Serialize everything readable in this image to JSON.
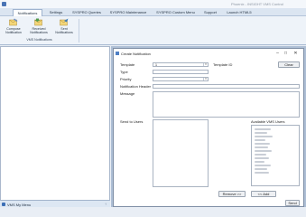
{
  "app": {
    "title": "Phoenix - INSIGHT VMS Control",
    "colors": {
      "accent": "#4a74b5",
      "ribbon": "#eef3f9",
      "workspace": "#aebfd5"
    }
  },
  "quick_access": {
    "icon": "app-menu-icon"
  },
  "tabs": [
    {
      "label": "Notifications",
      "active": true
    },
    {
      "label": "Settings",
      "active": false
    },
    {
      "label": "SYSPRO Queries",
      "active": false
    },
    {
      "label": "SYSPRO Maintenance",
      "active": false
    },
    {
      "label": "SYSPRO Custom Menu",
      "active": false
    },
    {
      "label": "Support",
      "active": false
    },
    {
      "label": "Launch HTML5",
      "active": false
    }
  ],
  "ribbon": {
    "buttons": [
      {
        "line1": "Compose",
        "line2": "Notification",
        "icon": "compose-icon"
      },
      {
        "line1": "Received",
        "line2": "Notifications",
        "icon": "received-icon"
      },
      {
        "line1": "Sent",
        "line2": "Notifications",
        "icon": "sent-icon"
      }
    ],
    "group_label": "VMS Notifications"
  },
  "left_pane": {
    "title": "VMS My Menu",
    "pin_glyph": "↑"
  },
  "dialog": {
    "title": "Create Notification",
    "window_buttons": {
      "minimize": "–",
      "maximize": "□",
      "close": "✕"
    },
    "fields": {
      "template_label": "Template",
      "template_value": "1",
      "template_id_label": "Template ID",
      "clear_button": "Clear",
      "type_label": "Type",
      "priority_label": "Priority",
      "notification_header_label": "Notification Header",
      "message_label": "Message",
      "send_to_users_label": "Send to Users",
      "available_users_label": "Available VMS Users"
    },
    "buttons": {
      "remove": "Remove >>",
      "add": "<< Add",
      "send": "Send"
    }
  }
}
